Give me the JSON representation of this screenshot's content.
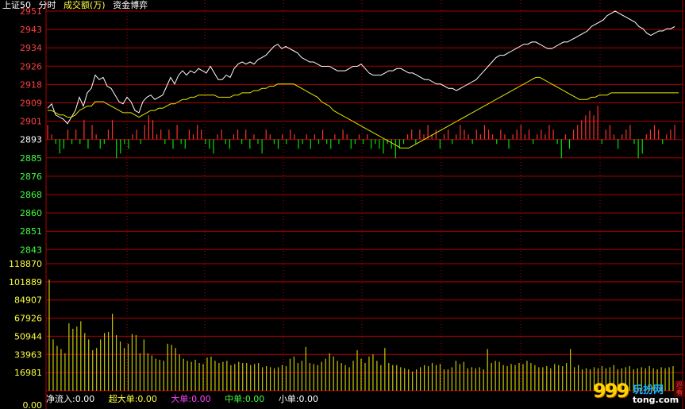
{
  "header": {
    "index_name": "上证50",
    "mode": "分时",
    "unit_label": "成交额(万)",
    "game_label": "资金博弈"
  },
  "footer": {
    "net_inflow": "净流入:0.00",
    "super_large": "超大单:0.00",
    "large": "大单:0.00",
    "medium": "中单:0.00",
    "small": "小单:0.00"
  },
  "colors": {
    "grid": "#b00000",
    "price_line": "#ffffff",
    "avg_line": "#e8e800",
    "up_bar": "#ff3030",
    "down_bar": "#00e000",
    "volume_bar": "#c8c800",
    "label_red": "#ff4040",
    "label_green": "#40ff40",
    "white": "#ffffff",
    "yellow": "#ffff40",
    "magenta": "#ff40ff",
    "green": "#40ff40"
  },
  "logo": {
    "number": "999",
    "word": "玩扮网",
    "domain": "tong.com",
    "side": "巡看"
  },
  "chart_data": [
    {
      "type": "line",
      "title": "",
      "prev_close": 2893,
      "price_ticks": [
        "2951",
        "2943",
        "2934",
        "2926",
        "2918",
        "2909",
        "2901",
        "2893",
        "2885",
        "2876",
        "2868",
        "2860",
        "2851",
        "2843"
      ],
      "ylim": [
        2843,
        2951
      ],
      "series": [
        {
          "values": [
            2907,
            2909,
            2904,
            2903,
            2902,
            2900,
            2903,
            2906,
            2912,
            2908,
            2914,
            2916,
            2922,
            2920,
            2921,
            2917,
            2916,
            2913,
            2910,
            2909,
            2912,
            2910,
            2906,
            2905,
            2910,
            2912,
            2913,
            2911,
            2912,
            2913,
            2917,
            2921,
            2918,
            2922,
            2924,
            2922,
            2924,
            2923,
            2925,
            2924,
            2923,
            2926,
            2923,
            2920,
            2920,
            2922,
            2921,
            2925,
            2927,
            2928,
            2927,
            2928,
            2927,
            2929,
            2930,
            2931,
            2933,
            2935,
            2936,
            2934,
            2935,
            2934,
            2933,
            2932,
            2930,
            2929,
            2928,
            2928,
            2927,
            2926,
            2926,
            2926,
            2925,
            2924,
            2924,
            2924,
            2925,
            2926,
            2926,
            2927,
            2925,
            2923,
            2922,
            2922,
            2922,
            2923,
            2924,
            2924,
            2925,
            2925,
            2924,
            2923,
            2923,
            2922,
            2921,
            2920,
            2920,
            2919,
            2918,
            2918,
            2917,
            2916,
            2916,
            2915,
            2916,
            2917,
            2918,
            2919,
            2920,
            2922,
            2924,
            2926,
            2928,
            2930,
            2931,
            2931,
            2932,
            2933,
            2934,
            2935,
            2936,
            2936,
            2937,
            2937,
            2936,
            2935,
            2934,
            2934,
            2935,
            2936,
            2937,
            2937,
            2938,
            2939,
            2940,
            2941,
            2942,
            2944,
            2945,
            2946,
            2947,
            2949,
            2950,
            2951,
            2950,
            2949,
            2948,
            2947,
            2946,
            2944,
            2943,
            2941,
            2940,
            2941,
            2942,
            2942,
            2943,
            2943,
            2944
          ]
        },
        {
          "values": [
            2906,
            2906,
            2905,
            2904,
            2904,
            2903,
            2903,
            2904,
            2906,
            2907,
            2908,
            2908,
            2910,
            2910,
            2910,
            2909,
            2908,
            2907,
            2906,
            2905,
            2905,
            2905,
            2904,
            2903,
            2904,
            2905,
            2906,
            2906,
            2907,
            2907,
            2908,
            2909,
            2909,
            2910,
            2911,
            2911,
            2912,
            2912,
            2913,
            2913,
            2913,
            2913,
            2913,
            2912,
            2912,
            2912,
            2912,
            2913,
            2913,
            2914,
            2914,
            2914,
            2915,
            2915,
            2916,
            2916,
            2917,
            2917,
            2918,
            2918,
            2918,
            2918,
            2918,
            2917,
            2916,
            2915,
            2914,
            2913,
            2912,
            2910,
            2909,
            2908,
            2906,
            2905,
            2904,
            2903,
            2902,
            2901,
            2900,
            2899,
            2898,
            2897,
            2896,
            2895,
            2894,
            2893,
            2892,
            2891,
            2890,
            2889,
            2889,
            2889,
            2890,
            2891,
            2892,
            2893,
            2894,
            2895,
            2896,
            2897,
            2898,
            2899,
            2900,
            2901,
            2902,
            2903,
            2904,
            2905,
            2906,
            2907,
            2908,
            2909,
            2910,
            2911,
            2912,
            2913,
            2914,
            2915,
            2916,
            2917,
            2918,
            2919,
            2920,
            2921,
            2921,
            2920,
            2919,
            2918,
            2917,
            2916,
            2915,
            2914,
            2913,
            2912,
            2911,
            2911,
            2911,
            2912,
            2912,
            2913,
            2913,
            2913,
            2914,
            2914,
            2914,
            2914,
            2914,
            2914,
            2914,
            2914,
            2914,
            2914,
            2914,
            2914,
            2914,
            2914,
            2914,
            2914,
            2914,
            2914
          ]
        }
      ]
    },
    {
      "type": "bar",
      "title": "",
      "values": [
        3,
        1,
        -1,
        -3,
        -2,
        2,
        -1,
        2,
        -1,
        4,
        -2,
        3,
        1,
        -2,
        -1,
        2,
        4,
        -4,
        -3,
        -1,
        -2,
        1,
        2,
        -1,
        3,
        5,
        4,
        1,
        2,
        -1,
        2,
        -2,
        3,
        -1,
        -2,
        2,
        1,
        3,
        2,
        -1,
        -2,
        -3,
        1,
        2,
        -1,
        -2,
        1,
        2,
        -1,
        2,
        -2,
        1,
        -1,
        -3,
        2,
        1,
        -1,
        -2,
        1,
        -1,
        2,
        1,
        -2,
        -1,
        1,
        -2,
        1,
        -1,
        2,
        -1,
        -2,
        1,
        -1,
        2,
        1,
        -2,
        -1,
        1,
        -1,
        1,
        -2,
        -1,
        -2,
        -3,
        -1,
        -2,
        -4,
        -2,
        -1,
        1,
        2,
        -1,
        2,
        1,
        3,
        1,
        2,
        -2,
        1,
        2,
        -1,
        1,
        3,
        2,
        1,
        -1,
        2,
        1,
        3,
        2,
        1,
        -1,
        2,
        1,
        -2,
        1,
        2,
        3,
        1,
        2,
        -1,
        1,
        2,
        1,
        3,
        2,
        -1,
        -4,
        1,
        -2,
        2,
        3,
        4,
        5,
        6,
        5,
        7,
        -1,
        2,
        3,
        1,
        -2,
        1,
        2,
        3,
        -1,
        -4,
        -3,
        1,
        2,
        3,
        2,
        -1,
        1,
        2,
        3
      ]
    },
    {
      "type": "bar",
      "title": "",
      "volume_ticks": [
        "118870",
        "101889",
        "84907",
        "67926",
        "50944",
        "33963",
        "16981",
        "0.00"
      ],
      "ylim": [
        0,
        118870
      ],
      "values": [
        104000,
        48000,
        42000,
        39000,
        35000,
        63000,
        58000,
        60000,
        65000,
        54000,
        48000,
        38000,
        40000,
        48000,
        54000,
        55000,
        72000,
        52000,
        46000,
        40000,
        44000,
        53000,
        52000,
        35000,
        48000,
        35000,
        33000,
        30000,
        29000,
        28000,
        44000,
        43000,
        40000,
        34000,
        30000,
        28000,
        27000,
        29000,
        26000,
        25000,
        31000,
        32000,
        28000,
        26000,
        27000,
        28000,
        24000,
        25000,
        27000,
        26000,
        26000,
        24000,
        25000,
        26000,
        22000,
        23000,
        22000,
        21000,
        22000,
        24000,
        23000,
        30000,
        32000,
        26000,
        28000,
        41000,
        26000,
        25000,
        24000,
        27000,
        30000,
        35000,
        32000,
        28000,
        26000,
        24000,
        22000,
        28000,
        38000,
        30000,
        26000,
        32000,
        34000,
        28000,
        24000,
        40000,
        26000,
        24000,
        24000,
        22000,
        21000,
        20000,
        18000,
        20000,
        22000,
        24000,
        23000,
        26000,
        24000,
        25000,
        20000,
        20000,
        22000,
        28000,
        25000,
        27000,
        21000,
        22000,
        21000,
        22000,
        20000,
        39000,
        26000,
        28000,
        27000,
        24000,
        23000,
        25000,
        24000,
        26000,
        25000,
        28000,
        26000,
        24000,
        22000,
        22000,
        23000,
        21000,
        25000,
        24000,
        23000,
        26000,
        39000,
        22000,
        24000,
        20000,
        21000,
        20000,
        22000,
        21000,
        23000,
        21000,
        22000,
        24000,
        20000,
        21000,
        22000,
        23000,
        20000,
        21000,
        22000,
        21000,
        23000,
        21000,
        20000,
        22000,
        21000,
        22000,
        23000
      ]
    }
  ]
}
